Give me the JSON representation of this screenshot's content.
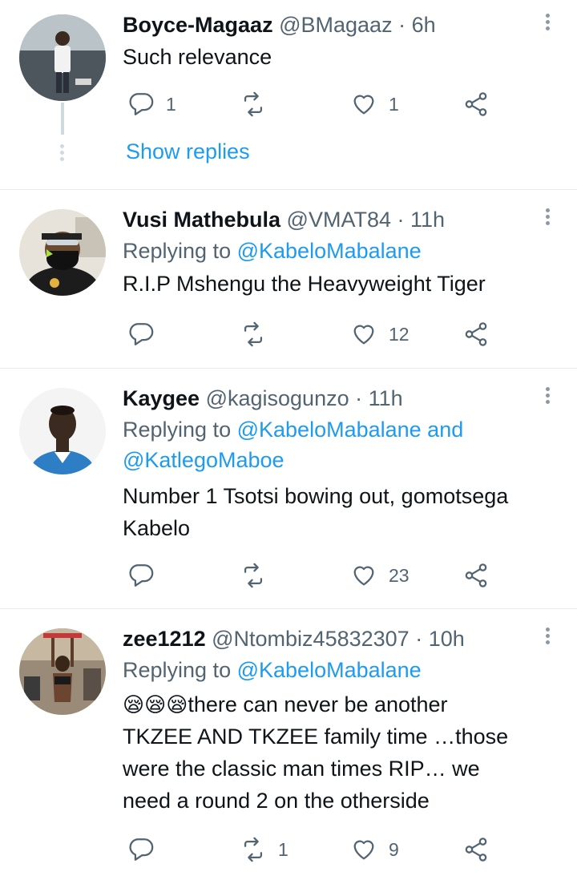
{
  "tweets": [
    {
      "name": "Boyce-Magaaz",
      "handle": "@BMagaaz",
      "time": "· 6h",
      "replying_prefix": "",
      "replying_to": "",
      "text": "Such relevance",
      "reply_count": "1",
      "retweet_count": "",
      "like_count": "1",
      "show_replies": "Show replies"
    },
    {
      "name": "Vusi Mathebula",
      "handle": "@VMAT84",
      "time": "· 11h",
      "replying_prefix": "Replying to",
      "replying_to": "@KabeloMabalane",
      "text": "R.I.P Mshengu the Heavyweight Tiger",
      "reply_count": "",
      "retweet_count": "",
      "like_count": "12"
    },
    {
      "name": "Kaygee",
      "handle": "@kagisogunzo",
      "time": "· 11h",
      "replying_prefix": "Replying to",
      "replying_to": "@KabeloMabalane and",
      "replying_to_2": "@KatlegoMaboe",
      "text_line1": "Number 1 Tsotsi bowing out, gomotsega",
      "text_line2": "Kabelo",
      "reply_count": "",
      "retweet_count": "",
      "like_count": "23"
    },
    {
      "name": "zee1212",
      "handle": "@Ntombiz45832307",
      "time": "· 10h",
      "replying_prefix": "Replying to",
      "replying_to": "@KabeloMabalane",
      "emoji": "😪😪😪",
      "text_line1": "there can never be another",
      "text_line2": "TKZEE AND TKZEE family time …those",
      "text_line3": "were the classic man times RIP… we",
      "text_line4": "need a round 2 on the otherside",
      "reply_count": "",
      "retweet_count": "1",
      "like_count": "9"
    }
  ],
  "icons": {
    "reply": "reply-icon",
    "retweet": "retweet-icon",
    "like": "heart-icon",
    "share": "share-icon",
    "more": "more-icon"
  },
  "colors": {
    "accent": "#1d9bf0",
    "secondary_text": "#536471",
    "divider": "#e6ecf0"
  }
}
